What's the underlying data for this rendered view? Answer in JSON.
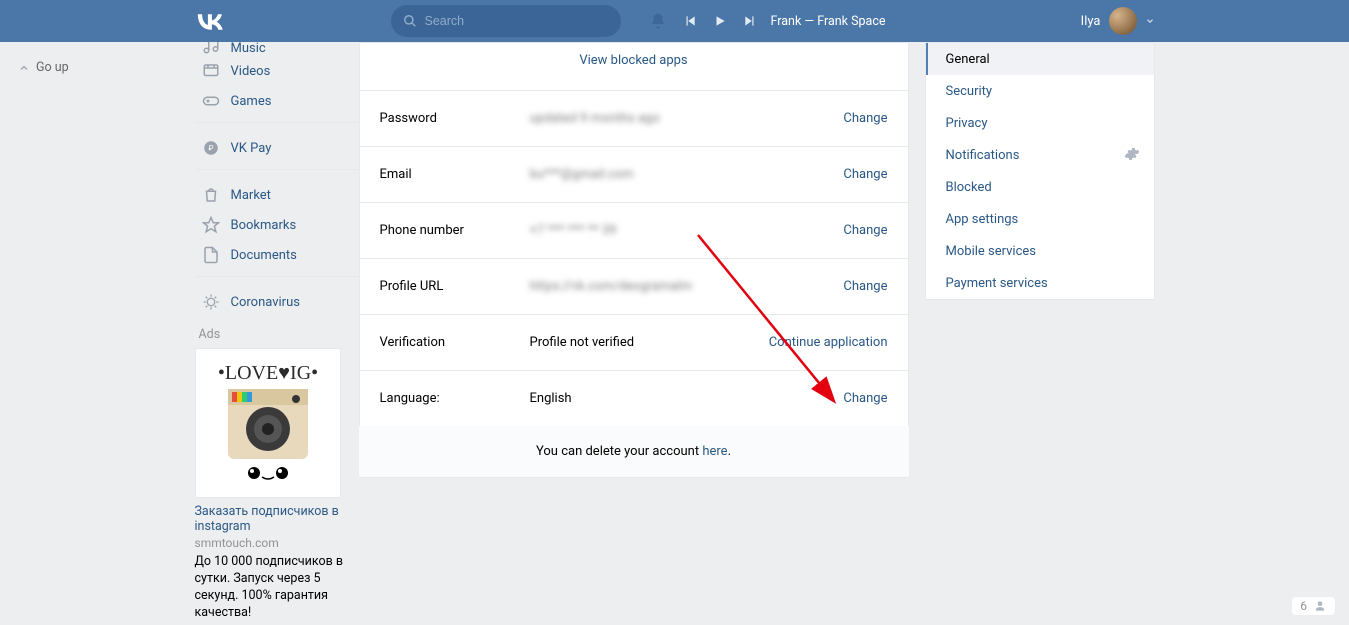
{
  "header": {
    "search_placeholder": "Search",
    "now_playing": "Frank — Frank Space",
    "user_name": "Ilya"
  },
  "go_up": "Go up",
  "nav": {
    "items": [
      {
        "id": "music",
        "label": "Music"
      },
      {
        "id": "videos",
        "label": "Videos"
      },
      {
        "id": "games",
        "label": "Games"
      },
      {
        "id": "vkpay",
        "label": "VK Pay"
      },
      {
        "id": "market",
        "label": "Market"
      },
      {
        "id": "bookmarks",
        "label": "Bookmarks"
      },
      {
        "id": "documents",
        "label": "Documents"
      },
      {
        "id": "coronavirus",
        "label": "Coronavirus"
      }
    ]
  },
  "ads": {
    "label": "Ads",
    "title": "Заказать подписчиков в instagram",
    "domain": "smmtouch.com",
    "text": "До 10 000 подписчиков в сутки. Запуск через 5 секунд. 100% гарантия качества!"
  },
  "settings": {
    "view_blocked_apps": "View blocked apps",
    "rows": {
      "password": {
        "label": "Password",
        "value": "updated 9 months ago",
        "action": "Change"
      },
      "email": {
        "label": "Email",
        "value": "bu***@gmail.com",
        "action": "Change"
      },
      "phone": {
        "label": "Phone number",
        "value": "+7 *** *** ** 39",
        "action": "Change"
      },
      "url": {
        "label": "Profile URL",
        "value": "https://vk.com/deogramalm",
        "action": "Change"
      },
      "verification": {
        "label": "Verification",
        "value": "Profile not verified",
        "action": "Continue application"
      },
      "language": {
        "label": "Language:",
        "value": "English",
        "action": "Change"
      }
    },
    "delete_text": "You can delete your account ",
    "delete_link": "here"
  },
  "tabs": [
    {
      "id": "general",
      "label": "General",
      "active": true
    },
    {
      "id": "security",
      "label": "Security"
    },
    {
      "id": "privacy",
      "label": "Privacy"
    },
    {
      "id": "notifications",
      "label": "Notifications",
      "gear": true
    },
    {
      "id": "blocked",
      "label": "Blocked"
    },
    {
      "id": "app",
      "label": "App settings"
    },
    {
      "id": "mobile",
      "label": "Mobile services"
    },
    {
      "id": "payment",
      "label": "Payment services"
    }
  ],
  "online_count": "6"
}
